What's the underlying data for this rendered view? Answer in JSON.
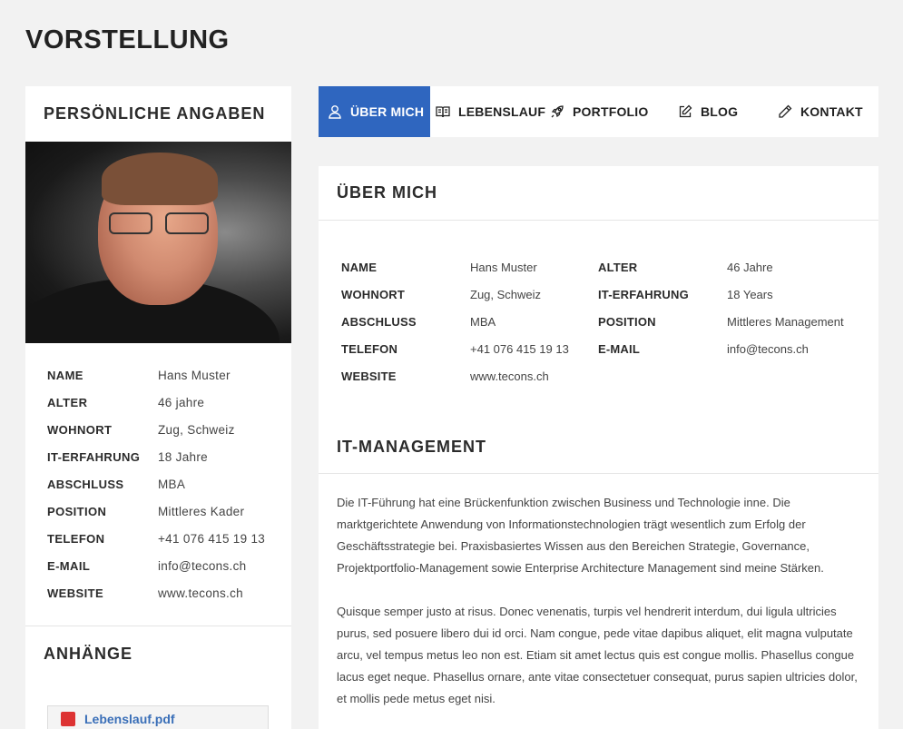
{
  "page_title": "VORSTELLUNG",
  "sidebar": {
    "title": "PERSÖNLICHE ANGABEN",
    "info": [
      {
        "label": "NAME",
        "value": "Hans Muster"
      },
      {
        "label": "ALTER",
        "value": "46 jahre"
      },
      {
        "label": "WOHNORT",
        "value": "Zug, Schweiz"
      },
      {
        "label": "IT-ERFAHRUNG",
        "value": "18 Jahre"
      },
      {
        "label": "ABSCHLUSS",
        "value": "MBA"
      },
      {
        "label": "POSITION",
        "value": "Mittleres Kader"
      },
      {
        "label": "TELEFON",
        "value": "+41 076 415 19 13"
      },
      {
        "label": "E-MAIL",
        "value": "info@tecons.ch"
      },
      {
        "label": "WEBSITE",
        "value": "www.tecons.ch"
      }
    ],
    "attachments_title": "ANHÄNGE",
    "attachment_name": "Lebenslauf.pdf"
  },
  "nav": [
    {
      "label": "ÜBER MICH",
      "icon": "user-icon",
      "active": true
    },
    {
      "label": "LEBENSLAUF",
      "icon": "book-icon",
      "active": false
    },
    {
      "label": "PORTFOLIO",
      "icon": "rocket-icon",
      "active": false
    },
    {
      "label": "BLOG",
      "icon": "edit-icon",
      "active": false
    },
    {
      "label": "KONTAKT",
      "icon": "pencil-icon",
      "active": false
    }
  ],
  "about": {
    "title": "ÜBER MICH",
    "left": [
      {
        "label": "NAME",
        "value": "Hans Muster"
      },
      {
        "label": "WOHNORT",
        "value": "Zug, Schweiz"
      },
      {
        "label": "ABSCHLUSS",
        "value": "MBA"
      },
      {
        "label": "TELEFON",
        "value": "+41 076 415 19 13"
      },
      {
        "label": "WEBSITE",
        "value": "www.tecons.ch"
      }
    ],
    "right": [
      {
        "label": "ALTER",
        "value": "46 Jahre"
      },
      {
        "label": "IT-ERFAHRUNG",
        "value": "18 Years"
      },
      {
        "label": "POSITION",
        "value": "Mittleres Management"
      },
      {
        "label": "E-MAIL",
        "value": "info@tecons.ch"
      }
    ]
  },
  "it_management": {
    "title": "IT-MANAGEMENT",
    "paragraph1": "Die IT-Führung hat eine Brückenfunktion zwischen Business und Technologie inne. Die marktgerichtete Anwendung von Informationstechnologien trägt wesentlich zum Erfolg der Geschäftsstrategie bei. Praxisbasiertes Wissen aus den Bereichen Strategie, Governance, Projektportfolio-Management sowie Enterprise Architecture Management sind meine Stärken.",
    "paragraph2": "Quisque semper justo at risus. Donec venenatis, turpis vel hendrerit interdum, dui ligula ultricies purus, sed posuere libero dui id orci. Nam congue, pede vitae dapibus aliquet, elit magna vulputate arcu, vel tempus metus leo non est. Etiam sit amet lectus quis est congue mollis. Phasellus congue lacus eget neque. Phasellus ornare, ante vitae consectetuer consequat, purus sapien ultricies dolor, et mollis pede metus eget nisi."
  },
  "colors": {
    "accent": "#2f66bf",
    "link": "#3a6fb8",
    "background": "#f2f2f2"
  }
}
